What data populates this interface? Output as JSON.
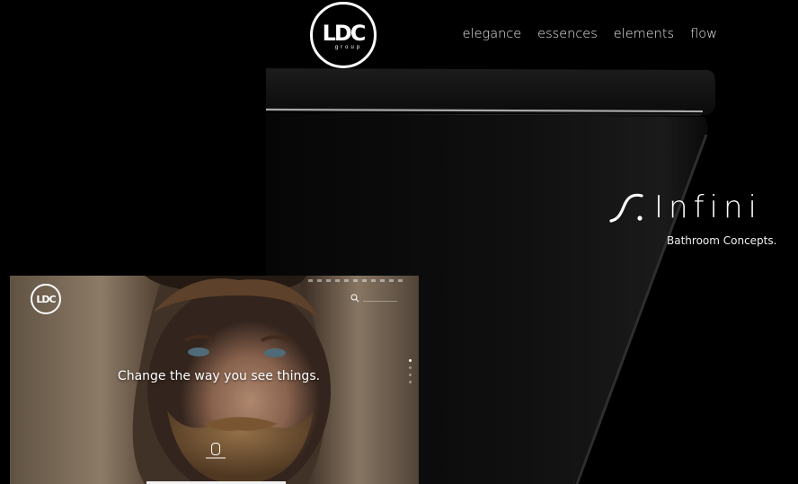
{
  "header": {
    "logo_text": "LDC",
    "logo_sub": "group",
    "nav": [
      {
        "label": "elegance"
      },
      {
        "label": "essences"
      },
      {
        "label": "elements"
      },
      {
        "label": "flow"
      }
    ]
  },
  "hero": {
    "brand_name": "Infini",
    "brand_tagline": "Bathroom Concepts.",
    "icon": "swoosh-icon"
  },
  "inset": {
    "logo_text": "LDC",
    "headline": "Change the way you see things."
  },
  "colors": {
    "background": "#000000",
    "text": "#ffffff"
  }
}
